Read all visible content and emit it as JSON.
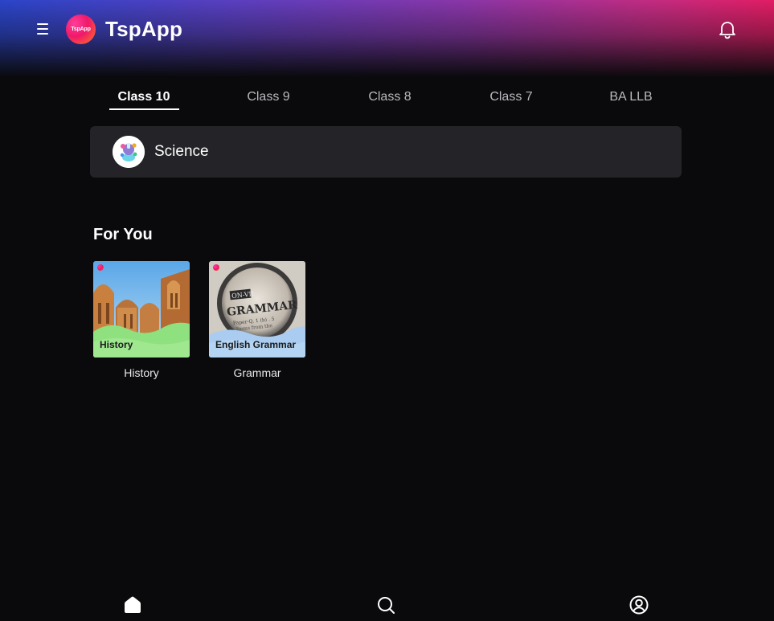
{
  "header": {
    "logo_text": "TspApp",
    "app_title": "TspApp",
    "menu_icon": "menu-icon",
    "notification_icon": "bell-icon"
  },
  "tabs": [
    {
      "label": "Class 10",
      "active": true
    },
    {
      "label": "Class 9",
      "active": false
    },
    {
      "label": "Class 8",
      "active": false
    },
    {
      "label": "Class 7",
      "active": false
    },
    {
      "label": "BA LLB",
      "active": false
    }
  ],
  "subjects": [
    {
      "label": "Science",
      "icon": "science-icon"
    }
  ],
  "for_you": {
    "title": "For You",
    "cards": [
      {
        "tag": "History",
        "caption": "History"
      },
      {
        "tag": "English Grammar",
        "caption": "Grammar"
      }
    ]
  },
  "bottom_nav": {
    "items": [
      {
        "icon": "home-icon",
        "active": true
      },
      {
        "icon": "search-icon",
        "active": false
      },
      {
        "icon": "profile-icon",
        "active": false
      }
    ]
  },
  "colors": {
    "background": "#0a0a0c",
    "card_background": "#242428",
    "header_gradient_start": "#2b45c9",
    "header_gradient_end": "#e21d64",
    "brand_pink": "#f0186a"
  }
}
